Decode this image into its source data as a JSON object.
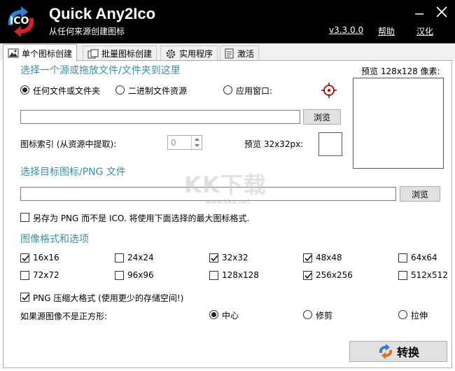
{
  "header": {
    "title": "Quick Any2Ico",
    "subtitle": "从任何来源创建图标",
    "version": "v3.3.0.0",
    "help": "帮助",
    "localize": "汉化",
    "logo_text": "ICO"
  },
  "tabs": [
    {
      "label": "单个图标创建",
      "icon": "image-icon",
      "active": true
    },
    {
      "label": "批量图标创建",
      "icon": "copy-icon",
      "active": false
    },
    {
      "label": "实用程序",
      "icon": "gear-icon",
      "active": false
    },
    {
      "label": "激活",
      "icon": "document-icon",
      "active": false
    }
  ],
  "source": {
    "title": "选择一个源或拖放文件/文件夹到这里",
    "radios": [
      {
        "label": "任何文件或文件夹",
        "selected": true
      },
      {
        "label": "二进制文件资源",
        "selected": false
      },
      {
        "label": "应用窗口:",
        "selected": false
      }
    ],
    "path_value": "",
    "browse_label": "浏览",
    "index_label": "图标索引 (从资源中提取):",
    "index_value": "0",
    "preview_small_label": "预览 32x32px:",
    "preview_large_label": "预览 128x128 像素:"
  },
  "target": {
    "title": "选择目标图标/PNG 文件",
    "path_value": "",
    "browse_label": "浏览",
    "save_png_label": "另存为 PNG 而不是 ICO. 将使用下面选择的最大图标格式.",
    "save_png_checked": false
  },
  "formats": {
    "title": "图像格式和选项",
    "items": [
      {
        "label": "16x16",
        "checked": true
      },
      {
        "label": "24x24",
        "checked": false
      },
      {
        "label": "32x32",
        "checked": true
      },
      {
        "label": "48x48",
        "checked": true
      },
      {
        "label": "64x64",
        "checked": false
      },
      {
        "label": "72x72",
        "checked": false
      },
      {
        "label": "96x96",
        "checked": false
      },
      {
        "label": "128x128",
        "checked": false
      },
      {
        "label": "256x256",
        "checked": true
      },
      {
        "label": "512x512",
        "checked": false
      }
    ],
    "png_compress_label": "PNG 压缩大格式 (使用更少的存储空间!)",
    "png_compress_checked": true,
    "non_square_label": "如果源图像不是正方形:",
    "non_square_options": [
      {
        "label": "中心",
        "selected": true
      },
      {
        "label": "修剪",
        "selected": false
      },
      {
        "label": "拉伸",
        "selected": false
      }
    ]
  },
  "convert_label": "转换",
  "watermark": {
    "text": "KK下载",
    "url": "www.kkx.net"
  },
  "colors": {
    "titlebar": "#000000",
    "section_title": "#3a8fa8",
    "accent_blue": "#2f7fd0",
    "accent_red": "#d4202a"
  }
}
